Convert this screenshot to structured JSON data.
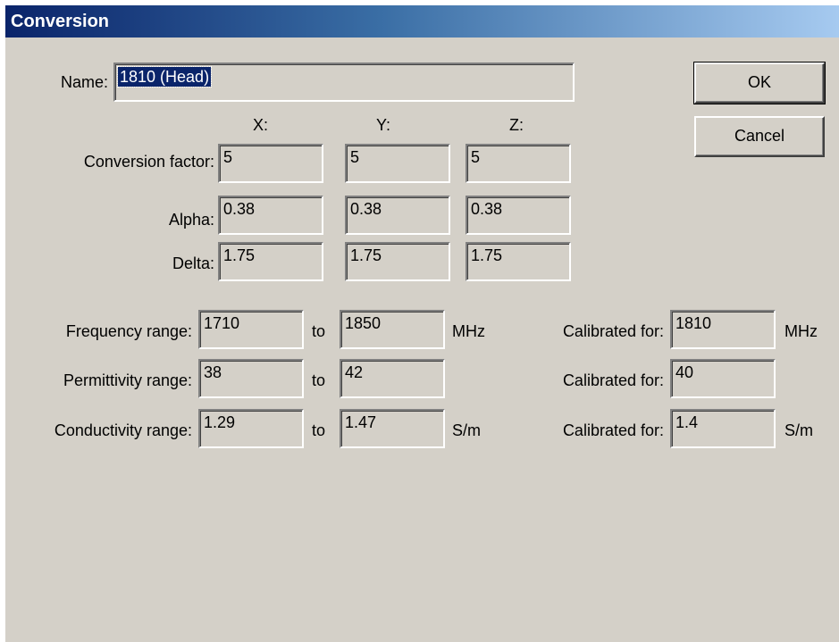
{
  "window": {
    "title": "Conversion"
  },
  "name": {
    "label": "Name:",
    "value": "1810 (Head)"
  },
  "buttons": {
    "ok": "OK",
    "cancel": "Cancel"
  },
  "axes": {
    "x": "X:",
    "y": "Y:",
    "z": "Z:"
  },
  "probe": {
    "conversion_factor": {
      "label": "Conversion factor:",
      "x": "5",
      "y": "5",
      "z": "5"
    },
    "alpha": {
      "label": "Alpha:",
      "x": "0.38",
      "y": "0.38",
      "z": "0.38"
    },
    "delta": {
      "label": "Delta:",
      "x": "1.75",
      "y": "1.75",
      "z": "1.75"
    }
  },
  "ranges": {
    "to_label": "to",
    "calibrated_label": "Calibrated for:",
    "frequency": {
      "label": "Frequency range:",
      "from": "1710",
      "to": "1850",
      "unit": "MHz",
      "calibrated": "1810",
      "cal_unit": "MHz"
    },
    "permittivity": {
      "label": "Permittivity range:",
      "from": "38",
      "to": "42",
      "unit": "",
      "calibrated": "40",
      "cal_unit": ""
    },
    "conductivity": {
      "label": "Conductivity range:",
      "from": "1.29",
      "to": "1.47",
      "unit": "S/m",
      "calibrated": "1.4",
      "cal_unit": "S/m"
    }
  }
}
